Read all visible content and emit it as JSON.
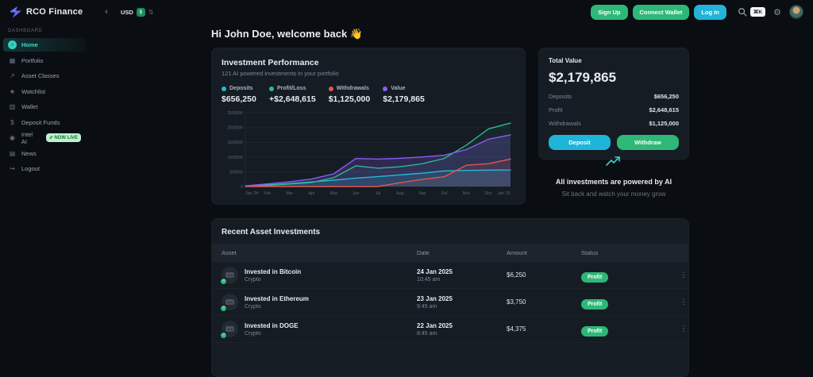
{
  "topbar": {
    "brand": "RCO Finance",
    "collapse_icon": "‹",
    "currency": {
      "code": "USD",
      "symbol": "$",
      "updown_icon": "⇅"
    },
    "sign_up": "Sign Up",
    "connect_wallet": "Connect Wallet",
    "log_in": "Log In",
    "shortcut": "⌘K",
    "gear_icon": "⚙"
  },
  "sidebar": {
    "section_label": "DASHBOARD",
    "items": [
      {
        "label": "Home",
        "icon": "⌂",
        "active": true
      },
      {
        "label": "Portfolio",
        "icon": "▦"
      },
      {
        "label": "Asset Classes",
        "icon": "↗"
      },
      {
        "label": "Watchlist",
        "icon": "★"
      },
      {
        "label": "Wallet",
        "icon": "▥"
      },
      {
        "label": "Deposit Funds",
        "icon": "$"
      },
      {
        "label": "Intel AI",
        "icon": "◉",
        "badge": "⇗ NOW LIVE"
      },
      {
        "label": "News",
        "icon": "▤"
      },
      {
        "label": "Logout",
        "icon": "↪"
      }
    ]
  },
  "main": {
    "greeting": "Hi John Doe, welcome back",
    "greeting_emoji": "👋"
  },
  "performance_card": {
    "title": "Investment Performance",
    "subtitle": "121 AI powered investments in your portfolio",
    "legend": [
      {
        "label": "Deposits",
        "value": "$656,250",
        "color": "#29b6d8"
      },
      {
        "label": "Profit/Loss",
        "value": "+$2,648,615",
        "color": "#2eb88a"
      },
      {
        "label": "Withdrawals",
        "value": "$1,125,000",
        "color": "#e2574b"
      },
      {
        "label": "Value",
        "value": "$2,179,865",
        "color": "#8b5cf6"
      }
    ]
  },
  "total_value_card": {
    "title": "Total Value",
    "value": "$2,179,865",
    "rows": [
      {
        "label": "Deposits",
        "value": "$656,250"
      },
      {
        "label": "Profit",
        "value": "$2,648,615"
      },
      {
        "label": "Withdrawals",
        "value": "$1,125,000"
      }
    ],
    "deposit_button": "Deposit",
    "withdraw_button": "Withdraw",
    "deposit_color": "#1fb5d9",
    "withdraw_color": "#2eb877"
  },
  "ai_promo": {
    "title": "All investments are powered by AI",
    "subtitle": "Sit back and watch your money grow"
  },
  "table": {
    "title": "Recent Asset Investments",
    "columns": [
      "Asset",
      "Date",
      "Amount",
      "Status"
    ],
    "kebab_icon": "⋮",
    "rows": [
      {
        "asset": "Invested in Bitcoin",
        "category": "Crypto",
        "date": "24 Jan 2025",
        "time": "10:45 am",
        "amount": "$6,250",
        "status": "Profit"
      },
      {
        "asset": "Invested in Ethereum",
        "category": "Crypto",
        "date": "23 Jan 2025",
        "time": "9:45 am",
        "amount": "$3,750",
        "status": "Profit"
      },
      {
        "asset": "Invested in DOGE",
        "category": "Crypto",
        "date": "22 Jan 2025",
        "time": "8:45 am",
        "amount": "$4,375",
        "status": "Profit"
      }
    ]
  },
  "chart_data": {
    "type": "area",
    "title": "Investment Performance",
    "x": [
      "Jan '24",
      "Feb",
      "Mar",
      "Apr",
      "May",
      "Jun",
      "Jul",
      "Aug",
      "Sep",
      "Oct",
      "Nov",
      "Dec",
      "Jan '25"
    ],
    "xlabel": "",
    "ylabel": "",
    "ylim": [
      0,
      2500000
    ],
    "yticks": [
      0,
      500000,
      1000000,
      1500000,
      2000000,
      2500000
    ],
    "grid": true,
    "legend_position": "top",
    "series": [
      {
        "name": "Deposits",
        "color": "#29b6d8",
        "values": [
          10000,
          55000,
          100000,
          155000,
          215000,
          285000,
          335000,
          395000,
          450000,
          530000,
          545000,
          555000,
          560000
        ]
      },
      {
        "name": "Profit/Loss",
        "color": "#2eb88a",
        "values": [
          5000,
          35000,
          85000,
          135000,
          300000,
          700000,
          620000,
          670000,
          770000,
          950000,
          1400000,
          1950000,
          2150000
        ]
      },
      {
        "name": "Withdrawals",
        "color": "#e2574b",
        "values": [
          0,
          0,
          0,
          0,
          0,
          0,
          0,
          130000,
          240000,
          330000,
          720000,
          770000,
          930000
        ]
      },
      {
        "name": "Value",
        "color": "#8b5cf6",
        "values": [
          20000,
          90000,
          160000,
          255000,
          430000,
          950000,
          930000,
          955000,
          1000000,
          1060000,
          1250000,
          1600000,
          1750000
        ]
      }
    ]
  }
}
